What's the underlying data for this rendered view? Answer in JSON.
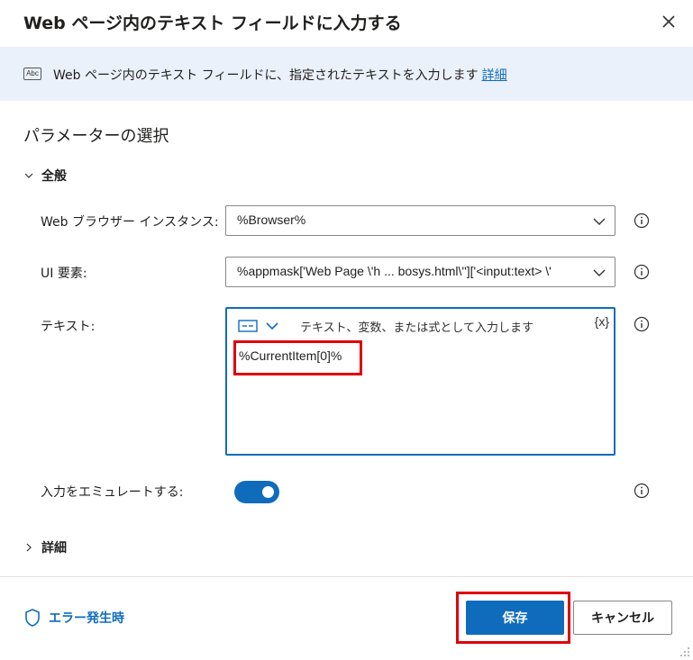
{
  "dialog": {
    "title": "Web ページ内のテキスト フィールドに入力する",
    "close_icon": "close-icon"
  },
  "banner": {
    "icon": "abc-icon",
    "icon_text": "Abc",
    "text": "Web ページ内のテキスト フィールドに、指定されたテキストを入力します",
    "link": "詳細"
  },
  "params": {
    "section_title": "パラメーターの選択",
    "general_group": "全般",
    "browser_instance": {
      "label": "Web ブラウザー インスタンス:",
      "value": "%Browser%"
    },
    "ui_element": {
      "label": "UI 要素:",
      "value": "%appmask['Web Page \\'h ... bosys.html\\'']['<input:text> \\'"
    },
    "text": {
      "label": "テキスト:",
      "placeholder": "テキスト、変数、または式として入力します",
      "var_button": "{x}",
      "value": "%CurrentItem[0]%"
    },
    "emulate": {
      "label": "入力をエミュレートする:",
      "enabled": true
    },
    "detail_group": "詳細"
  },
  "footer": {
    "error_link": "エラー発生時",
    "save": "保存",
    "cancel": "キャンセル"
  },
  "colors": {
    "accent": "#0f6cbd",
    "banner_bg": "#eaf1fb",
    "highlight": "#e0000b"
  }
}
